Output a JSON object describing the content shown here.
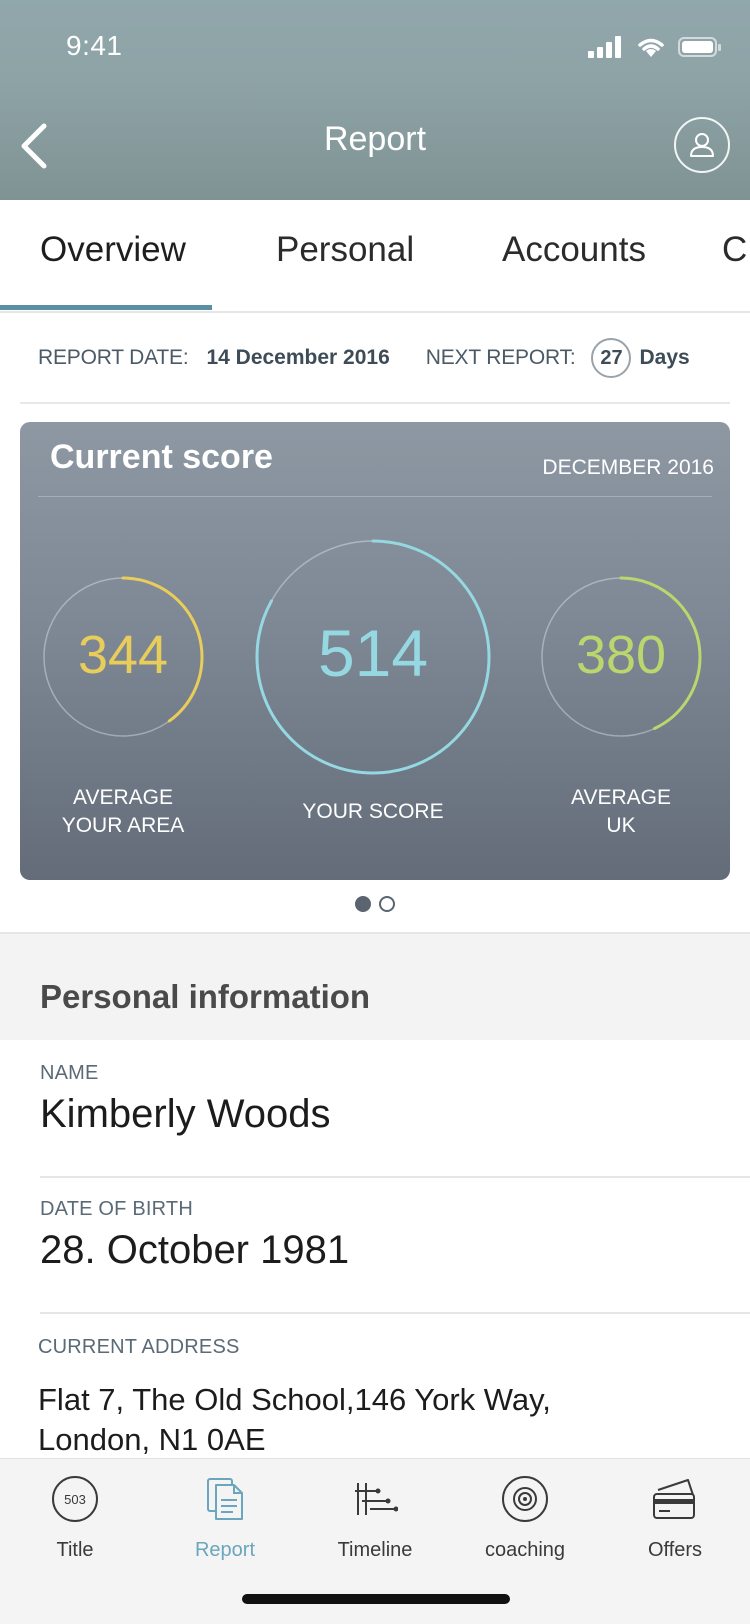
{
  "status_bar": {
    "time": "9:41"
  },
  "header": {
    "title": "Report"
  },
  "tabs": [
    {
      "label": "Overview",
      "active": true
    },
    {
      "label": "Personal",
      "active": false
    },
    {
      "label": "Accounts",
      "active": false
    },
    {
      "label": "C",
      "active": false
    }
  ],
  "report_info": {
    "report_date_label": "REPORT DATE:",
    "report_date": "14 December 2016",
    "next_report_label": "NEXT REPORT:",
    "next_report_days": "27",
    "days_unit": "Days"
  },
  "score_card": {
    "title": "Current score",
    "date": "DECEMBER 2016",
    "gauges": [
      {
        "value": "344",
        "label_line1": "AVERAGE",
        "label_line2": "YOUR AREA",
        "color": "#e8cd5b",
        "fill_fraction": 0.4
      },
      {
        "value": "514",
        "label_line1": "YOUR SCORE",
        "label_line2": "",
        "color": "#95d8e2",
        "fill_fraction": 0.83
      },
      {
        "value": "380",
        "label_line1": "AVERAGE",
        "label_line2": "UK",
        "color": "#bcd66e",
        "fill_fraction": 0.43
      }
    ]
  },
  "pagination": {
    "pages": 2,
    "current": 1
  },
  "personal_info": {
    "title": "Personal information",
    "name_label": "NAME",
    "name": "Kimberly Woods",
    "dob_label": "DATE OF BIRTH",
    "dob": "28. October 1981",
    "address_label": "CURRENT ADDRESS",
    "address_line1": "Flat 7, The Old School,146 York Way,",
    "address_line2": "London, N1 0AE"
  },
  "tab_bar": {
    "items": [
      {
        "label": "Title",
        "icon": "score-badge-icon",
        "badge": "503",
        "active": false
      },
      {
        "label": "Report",
        "icon": "document-icon",
        "active": true
      },
      {
        "label": "Timeline",
        "icon": "timeline-icon",
        "active": false
      },
      {
        "label": "coaching",
        "icon": "target-icon",
        "active": false
      },
      {
        "label": "Offers",
        "icon": "cards-icon",
        "active": false
      }
    ]
  },
  "colors": {
    "accent": "#5b8fa5",
    "active_tab_label": "#6aa6bd"
  }
}
